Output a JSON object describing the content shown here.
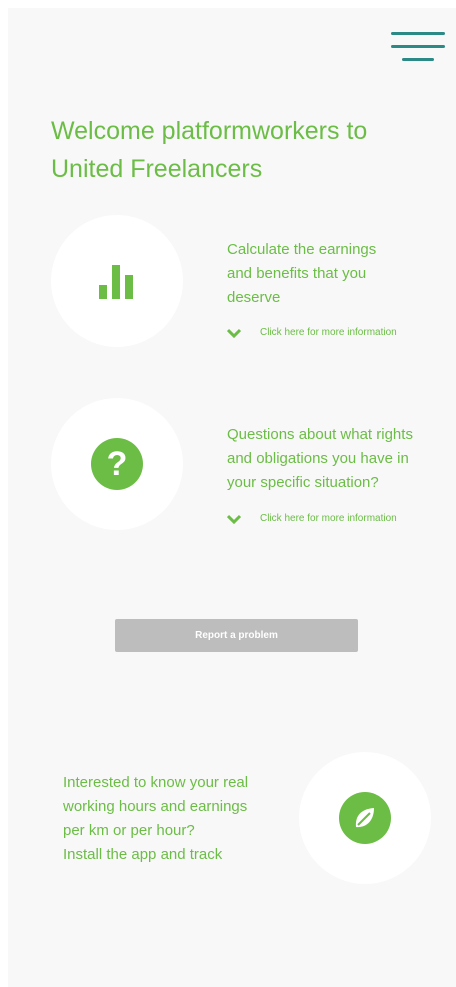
{
  "header": {
    "menu_icon": "hamburger-menu-icon",
    "accent": "#2b8a86"
  },
  "welcome": {
    "line1": "Welcome platformworkers to",
    "line2": "United Freelancers"
  },
  "sections": [
    {
      "icon": "bar-chart-icon",
      "lines": [
        "Calculate the earnings",
        "and benefits that you",
        "deserve"
      ],
      "more_label": "Click here for more information"
    },
    {
      "icon": "question-mark-icon",
      "lines": [
        "Questions about what rights",
        "and obligations you have in",
        "your specific situation?"
      ],
      "more_label": "Click here for more information"
    }
  ],
  "report_button": "Report a problem",
  "tracker": {
    "icon": "compass-leaf-icon",
    "lines": [
      "Interested to know your real",
      "working hours and earnings",
      "per km or per hour?",
      "Install the app and track"
    ]
  },
  "colors": {
    "brand_green": "#6bbd45",
    "button_gray": "#bdbdbd",
    "background": "#f8f8f8"
  }
}
